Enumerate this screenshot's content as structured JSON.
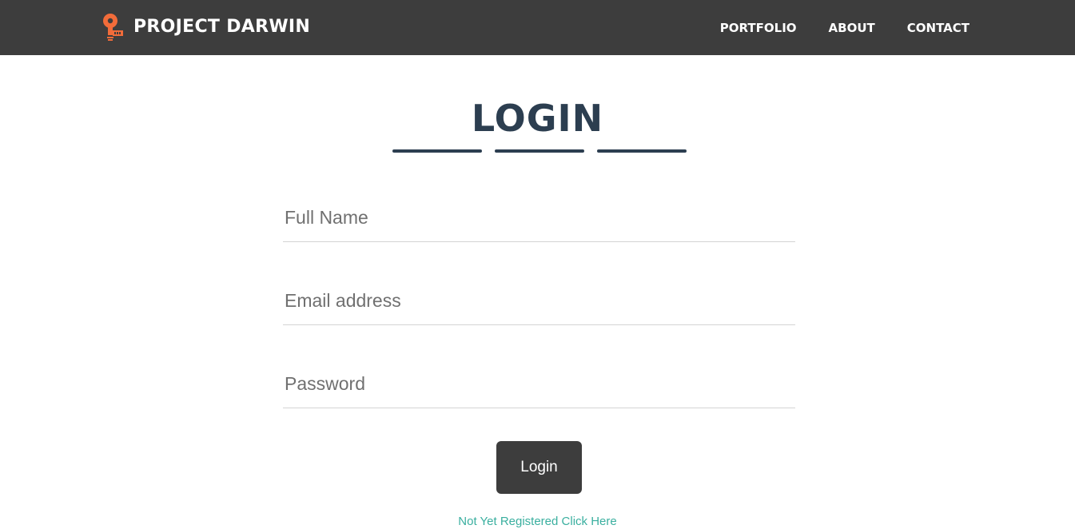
{
  "navbar": {
    "brand": "PROJECT DARWIN",
    "logo_icon": "lightbulb-logo-icon",
    "links": [
      "PORTFOLIO",
      "ABOUT",
      "CONTACT"
    ],
    "background": "#3d3d3d",
    "logo_color": "#f26c3a"
  },
  "page": {
    "heading": "LOGIN",
    "heading_color": "#2c3e50"
  },
  "form": {
    "full_name_placeholder": "Full Name",
    "email_placeholder": "Email address",
    "password_placeholder": "Password",
    "submit_label": "Login",
    "register_link": "Not Yet Registered Click Here"
  }
}
